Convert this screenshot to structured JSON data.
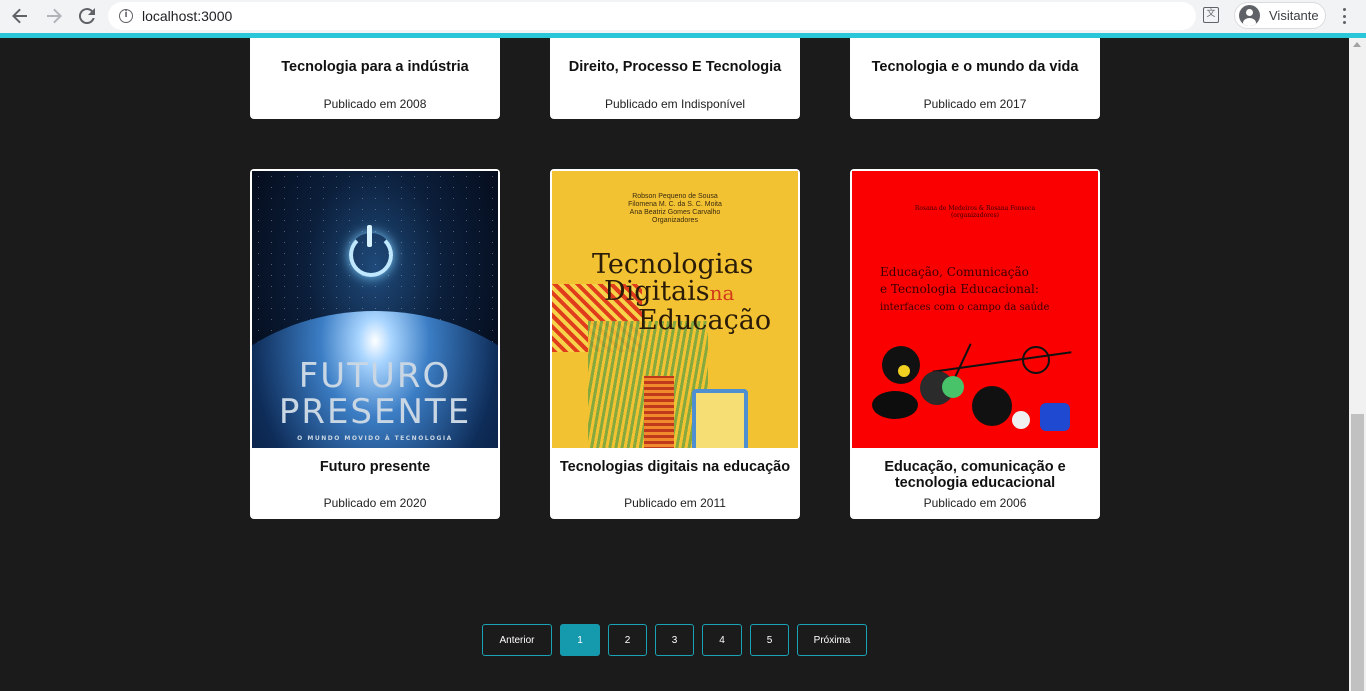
{
  "browser": {
    "url": "localhost:3000",
    "profile_name": "Visitante",
    "icons": [
      "back-arrow-icon",
      "forward-arrow-icon",
      "reload-icon",
      "info-icon",
      "translate-icon",
      "profile-avatar-icon",
      "more-vert-icon"
    ]
  },
  "theme": {
    "accent": "#29c5d9",
    "page_bg": "#1b1b1b",
    "pagination_border": "#1aa3b6",
    "pagination_active": "#159aad"
  },
  "books_top_row": [
    {
      "title": "Tecnologia para a indústria",
      "published": "Publicado em 2008"
    },
    {
      "title": "Direito, Processo E Tecnologia",
      "published": "Publicado em Indisponível"
    },
    {
      "title": "Tecnologia e o mundo da vida",
      "published": "Publicado em 2017"
    }
  ],
  "books_bottom_row": [
    {
      "title": "Futuro presente",
      "published": "Publicado em 2020",
      "cover": {
        "line1": "FUTURO",
        "line2": "PRESENTE",
        "line3": "O MUNDO MOVIDO À TECNOLOGIA"
      }
    },
    {
      "title": "Tecnologias digitais na educação",
      "published": "Publicado em 2011",
      "cover": {
        "authors": [
          "Robson Pequeno de Sousa",
          "Filomena M. C. da S. C. Moita",
          "Ana Beatriz Gomes Carvalho",
          "Organizadores"
        ],
        "line1": "Tecnologias",
        "line2": "Digitais",
        "na": "na",
        "line3": "Educação"
      }
    },
    {
      "title": "Educação, comunicação e tecnologia educacional",
      "published": "Publicado em 2006",
      "cover": {
        "top": "Rosana de Medeiros & Rosana Fonseca",
        "top2": "(organizadores)",
        "line1": "Educação, Comunicação",
        "line2": "e Tecnologia Educacional:",
        "line3": "interfaces com o campo da saúde"
      }
    }
  ],
  "pagination": {
    "prev": "Anterior",
    "pages": [
      "1",
      "2",
      "3",
      "4",
      "5"
    ],
    "active": "1",
    "next": "Próxima"
  }
}
